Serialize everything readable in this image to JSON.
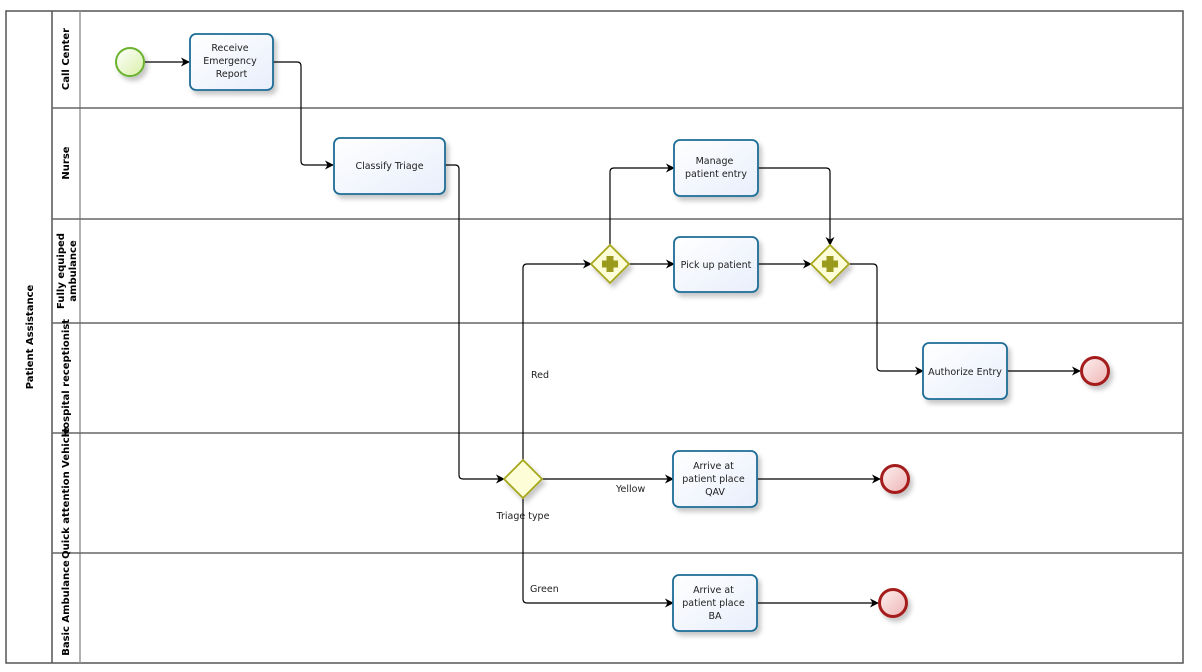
{
  "diagram": {
    "type": "BPMN collaboration",
    "pool": {
      "label": "Patient Assistance"
    },
    "lanes": [
      {
        "id": "call-center",
        "label": "Call Center"
      },
      {
        "id": "nurse",
        "label": "Nurse"
      },
      {
        "id": "ambulance",
        "label_lines": [
          "Fully equiped",
          "ambulance"
        ]
      },
      {
        "id": "receptionist",
        "label": "Hospital receptionist"
      },
      {
        "id": "qav",
        "label": "Quick attention Vehicle"
      },
      {
        "id": "basic",
        "label": "Basic Ambulance"
      }
    ],
    "events": {
      "start": {
        "type": "start",
        "lane": "call-center"
      },
      "end_entry": {
        "type": "end",
        "lane": "receptionist"
      },
      "end_qav": {
        "type": "end",
        "lane": "qav"
      },
      "end_ba": {
        "type": "end",
        "lane": "basic"
      }
    },
    "tasks": {
      "receive": {
        "lines": [
          "Receive",
          "Emergency",
          "Report"
        ],
        "lane": "call-center"
      },
      "classify": {
        "lines": [
          "Classify Triage"
        ],
        "lane": "nurse"
      },
      "manage": {
        "lines": [
          "Manage",
          "patient entry"
        ],
        "lane": "nurse"
      },
      "pickup": {
        "lines": [
          "Pick up patient"
        ],
        "lane": "ambulance"
      },
      "authorize": {
        "lines": [
          "Authorize Entry"
        ],
        "lane": "receptionist"
      },
      "arrive_qav": {
        "lines": [
          "Arrive at",
          "patient place",
          "QAV"
        ],
        "lane": "qav"
      },
      "arrive_ba": {
        "lines": [
          "Arrive at",
          "patient place",
          "BA"
        ],
        "lane": "basic"
      }
    },
    "gateways": {
      "triage": {
        "type": "exclusive",
        "label": "Triage type",
        "lane": "qav"
      },
      "split": {
        "type": "parallel",
        "lane": "ambulance"
      },
      "join": {
        "type": "parallel",
        "lane": "ambulance"
      }
    },
    "flow_labels": {
      "red": "Red",
      "yellow": "Yellow",
      "green": "Green"
    },
    "colors": {
      "task_stroke": "#1e6c96",
      "task_fill": "#eef3fc",
      "start_stroke": "#6ab32e",
      "start_fill": "#eaf7cf",
      "end_stroke": "#a51c1c",
      "end_fill": "#f2c9c9",
      "gateway_stroke": "#a7a71c",
      "gateway_fill": "#fdfdd8",
      "gateway_marker": "#9a9a1a",
      "lane_border": "#666666"
    }
  }
}
